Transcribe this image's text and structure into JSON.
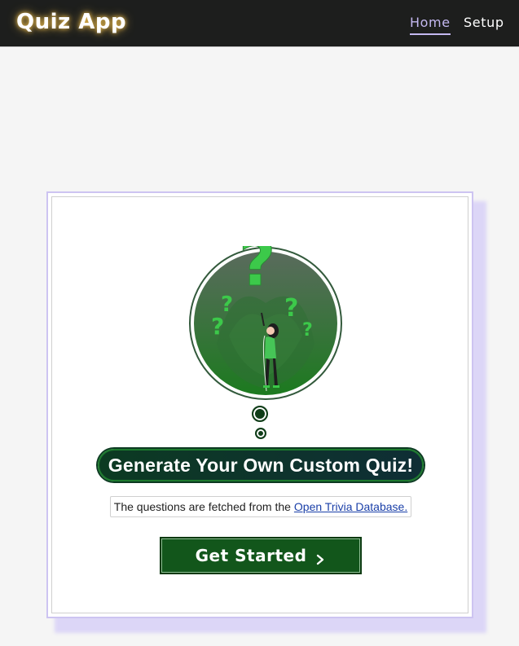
{
  "navbar": {
    "brand": "Quiz App",
    "links": [
      {
        "label": "Home",
        "active": true
      },
      {
        "label": "Setup",
        "active": false
      }
    ],
    "colors": {
      "background": "#1d1e1d",
      "active_link": "#c4b8f0",
      "brand_glow": "#f2c14e"
    }
  },
  "card": {
    "hero_icon": "question-marks-person-illustration",
    "headline": "Generate Your Own Custom Quiz!",
    "info_prefix": "The questions are fetched from the",
    "info_link": "Open Trivia Database.",
    "button_label": "Get Started",
    "button_icon": "chevron-right-icon",
    "colors": {
      "accent_green": "#12561b",
      "card_border": "#cdc4f1"
    }
  }
}
